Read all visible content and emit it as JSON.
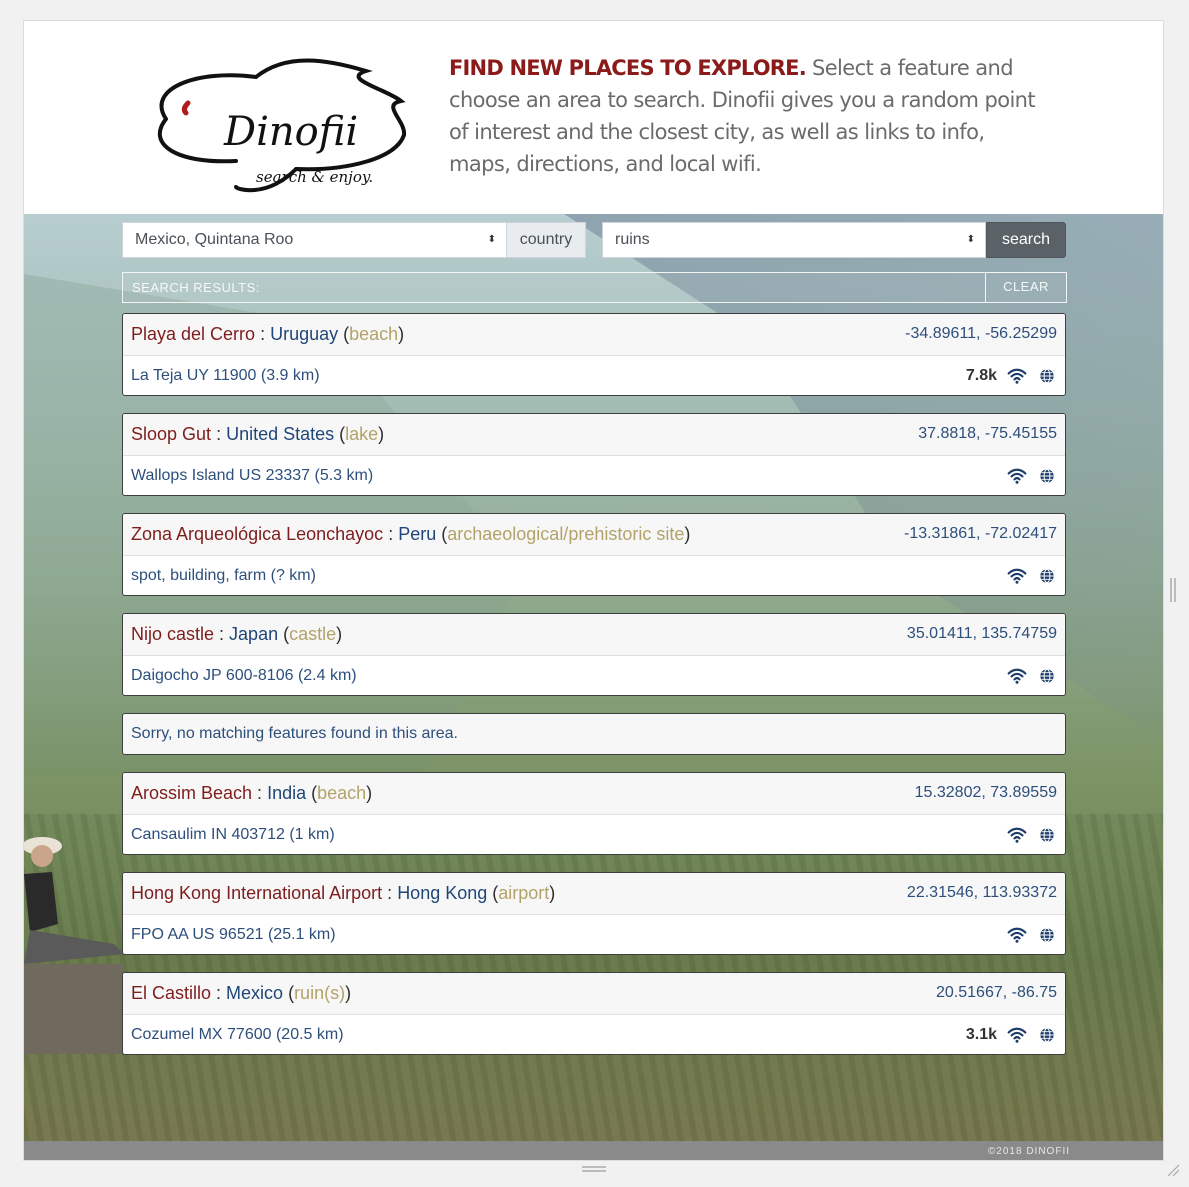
{
  "header": {
    "logo_text": "Dinofii",
    "logo_tagline": "search & enjoy.",
    "lead": "FIND NEW PLACES TO EXPLORE.",
    "description": " Select a feature and choose an area to search. Dinofii gives you a random point of interest and the closest city, as well as links to info, maps, directions, and local wifi."
  },
  "search": {
    "area_value": "Mexico, Quintana Roo",
    "area_addon": "country",
    "feature_value": "ruins",
    "button_label": "search"
  },
  "results_bar": {
    "label": "SEARCH RESULTS:",
    "clear_label": "CLEAR"
  },
  "results": [
    {
      "place": "Playa del Cerro",
      "country": "Uruguay",
      "type": "beach",
      "coords": "-34.89611, -56.25299",
      "city": "La Teja UY 11900 (3.9 km)",
      "views": "7.8k"
    },
    {
      "place": "Sloop Gut",
      "country": "United States",
      "type": "lake",
      "coords": "37.8818, -75.45155",
      "city": "Wallops Island US 23337 (5.3 km)",
      "views": ""
    },
    {
      "place": "Zona Arqueológica Leonchayoc",
      "country": "Peru",
      "type": "archaeological/prehistoric site",
      "coords": "-13.31861, -72.02417",
      "city": "spot, building, farm (? km)",
      "views": ""
    },
    {
      "place": "Nijo castle",
      "country": "Japan",
      "type": "castle",
      "coords": "35.01411, 135.74759",
      "city": "Daigocho JP 600-8106 (2.4 km)",
      "views": ""
    },
    {
      "place": "Arossim Beach",
      "country": "India",
      "type": "beach",
      "coords": "15.32802, 73.89559",
      "city": "Cansaulim IN 403712 (1 km)",
      "views": ""
    },
    {
      "place": "Hong Kong International Airport",
      "country": "Hong Kong",
      "type": "airport",
      "coords": "22.31546, 113.93372",
      "city": "FPO AA US 96521 (25.1 km)",
      "views": ""
    },
    {
      "place": "El Castillo",
      "country": "Mexico",
      "type": "ruin(s)",
      "coords": "20.51667, -86.75",
      "city": "Cozumel MX 77600 (20.5 km)",
      "views": "3.1k"
    }
  ],
  "no_match_message": "Sorry, no matching features found in this area.",
  "footer": {
    "copyright": "©2018 DINOFII"
  },
  "icons": {
    "wifi": "wifi-icon",
    "globe": "globe-icon",
    "select_caret": "updown-caret-icon"
  },
  "colors": {
    "brand_red": "#8b1a1a",
    "place_color": "#7e1d1d",
    "country_color": "#1f4678",
    "type_color": "#b3a26a",
    "link_blue": "#2d4f7c",
    "button_gray": "#5a6268"
  }
}
